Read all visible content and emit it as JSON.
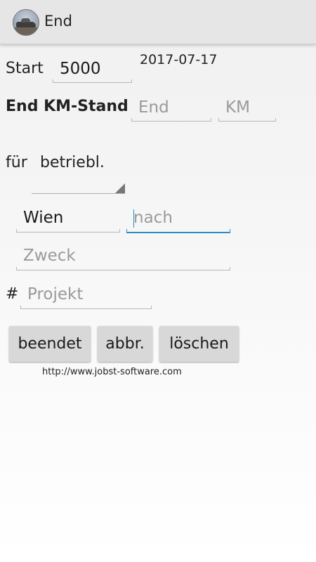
{
  "header": {
    "title": "End",
    "icon": "app-car-icon"
  },
  "start": {
    "label": "Start",
    "value": "5000",
    "date": "2017-07-17"
  },
  "end": {
    "label": "End KM-Stand",
    "end_placeholder": "End",
    "km_placeholder": "KM"
  },
  "purpose": {
    "label": "für",
    "value": "betriebl."
  },
  "route": {
    "from": "Wien",
    "to_placeholder": "nach"
  },
  "zweck": {
    "placeholder": "Zweck"
  },
  "projekt": {
    "hash": "#",
    "placeholder": "Projekt"
  },
  "buttons": {
    "finish": "beendet",
    "abort": "abbr.",
    "delete": "löschen"
  },
  "footer": {
    "link": "http://www.jobst-software.com"
  },
  "colors": {
    "accent": "#2a8fbf",
    "actionbar": "#e6e6e6",
    "button": "#d8d8d8"
  }
}
